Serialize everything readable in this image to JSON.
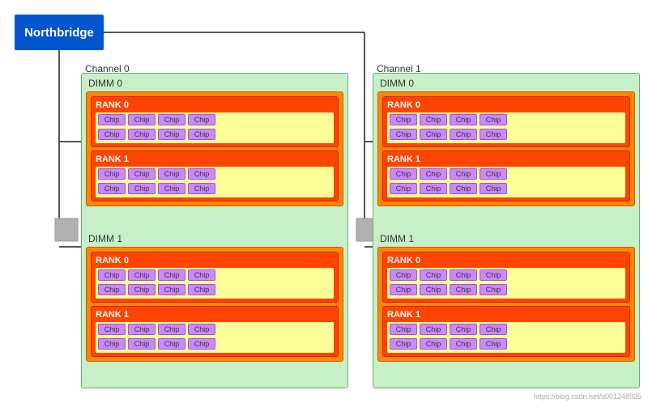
{
  "northbridge": {
    "label": "Northbridge"
  },
  "channels": [
    {
      "label": "Channel 0",
      "dimms": [
        {
          "label": "DIMM 0",
          "ranks": [
            {
              "label": "RANK 0",
              "rows": [
                [
                  "Chip",
                  "Chip",
                  "Chip",
                  "Chip"
                ],
                [
                  "Chip",
                  "Chip",
                  "Chip",
                  "Chip"
                ]
              ]
            },
            {
              "label": "RANK 1",
              "rows": [
                [
                  "Chip",
                  "Chip",
                  "Chip",
                  "Chip"
                ],
                [
                  "Chip",
                  "Chip",
                  "Chip",
                  "Chip"
                ]
              ]
            }
          ]
        },
        {
          "label": "DIMM 1",
          "ranks": [
            {
              "label": "RANK 0",
              "rows": [
                [
                  "Chip",
                  "Chip",
                  "Chip",
                  "Chip"
                ],
                [
                  "Chip",
                  "Chip",
                  "Chip",
                  "Chip"
                ]
              ]
            },
            {
              "label": "RANK 1",
              "rows": [
                [
                  "Chip",
                  "Chip",
                  "Chip",
                  "Chip"
                ],
                [
                  "Chip",
                  "Chip",
                  "Chip",
                  "Chip"
                ]
              ]
            }
          ]
        }
      ]
    },
    {
      "label": "Channel 1",
      "dimms": [
        {
          "label": "DIMM 0",
          "ranks": [
            {
              "label": "RANK 0",
              "rows": [
                [
                  "Chip",
                  "Chip",
                  "Chip",
                  "Chip"
                ],
                [
                  "Chip",
                  "Chip",
                  "Chip",
                  "Chip"
                ]
              ]
            },
            {
              "label": "RANK 1",
              "rows": [
                [
                  "Chip",
                  "Chip",
                  "Chip",
                  "Chip"
                ],
                [
                  "Chip",
                  "Chip",
                  "Chip",
                  "Chip"
                ]
              ]
            }
          ]
        },
        {
          "label": "DIMM 1",
          "ranks": [
            {
              "label": "RANK 0",
              "rows": [
                [
                  "Chip",
                  "Chip",
                  "Chip",
                  "Chip"
                ],
                [
                  "Chip",
                  "Chip",
                  "Chip",
                  "Chip"
                ]
              ]
            },
            {
              "label": "RANK 1",
              "rows": [
                [
                  "Chip",
                  "Chip",
                  "Chip",
                  "Chip"
                ],
                [
                  "Chip",
                  "Chip",
                  "Chip",
                  "Chip"
                ]
              ]
            }
          ]
        }
      ]
    }
  ],
  "watermark": "https://blog.csdn.net/u001248925"
}
